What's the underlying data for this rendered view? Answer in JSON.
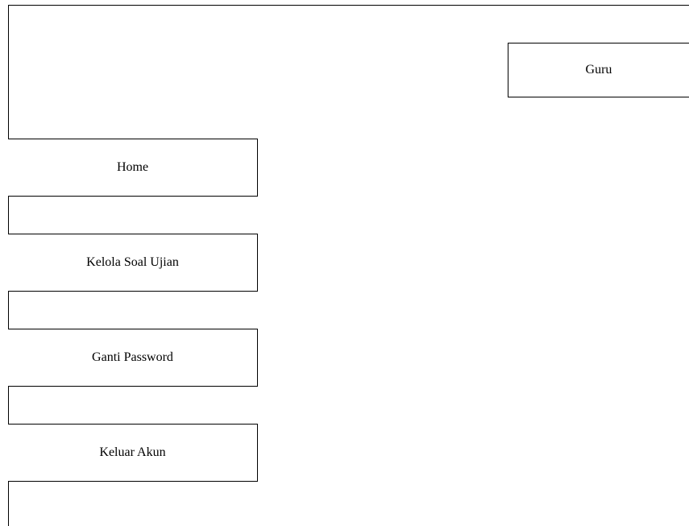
{
  "header": {
    "role_label": "Guru"
  },
  "sidebar": {
    "items": [
      {
        "label": "Home"
      },
      {
        "label": "Kelola Soal Ujian"
      },
      {
        "label": "Ganti Password"
      },
      {
        "label": "Keluar Akun"
      }
    ]
  }
}
